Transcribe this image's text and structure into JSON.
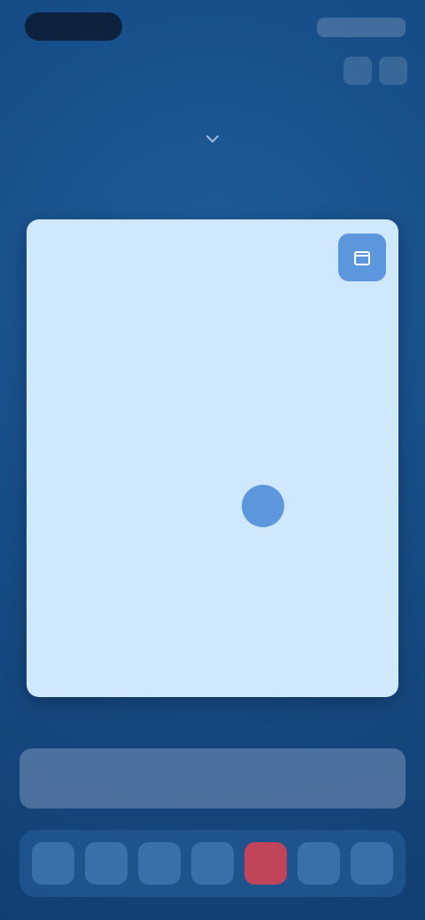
{
  "status_bar": {
    "time": ""
  },
  "header": {
    "title": "",
    "subtitle": ""
  },
  "calendar": {
    "title": "",
    "month": "",
    "weekdays": [
      "",
      "",
      "",
      "",
      "",
      "",
      ""
    ],
    "days": [
      "",
      "",
      "",
      "",
      "",
      "",
      "",
      "",
      "",
      "",
      "",
      "",
      "",
      "",
      "",
      "",
      "",
      "",
      "",
      "",
      "",
      "",
      "",
      "",
      "",
      "",
      "",
      "",
      "",
      "",
      "",
      "",
      "",
      "",
      "",
      "",
      ""
    ],
    "selected_index": 18,
    "accent_color": "#5c97de",
    "card_color": "#cfe8fb"
  },
  "icons": {
    "chevron": "chevron-down-icon",
    "today": "calendar-icon"
  }
}
